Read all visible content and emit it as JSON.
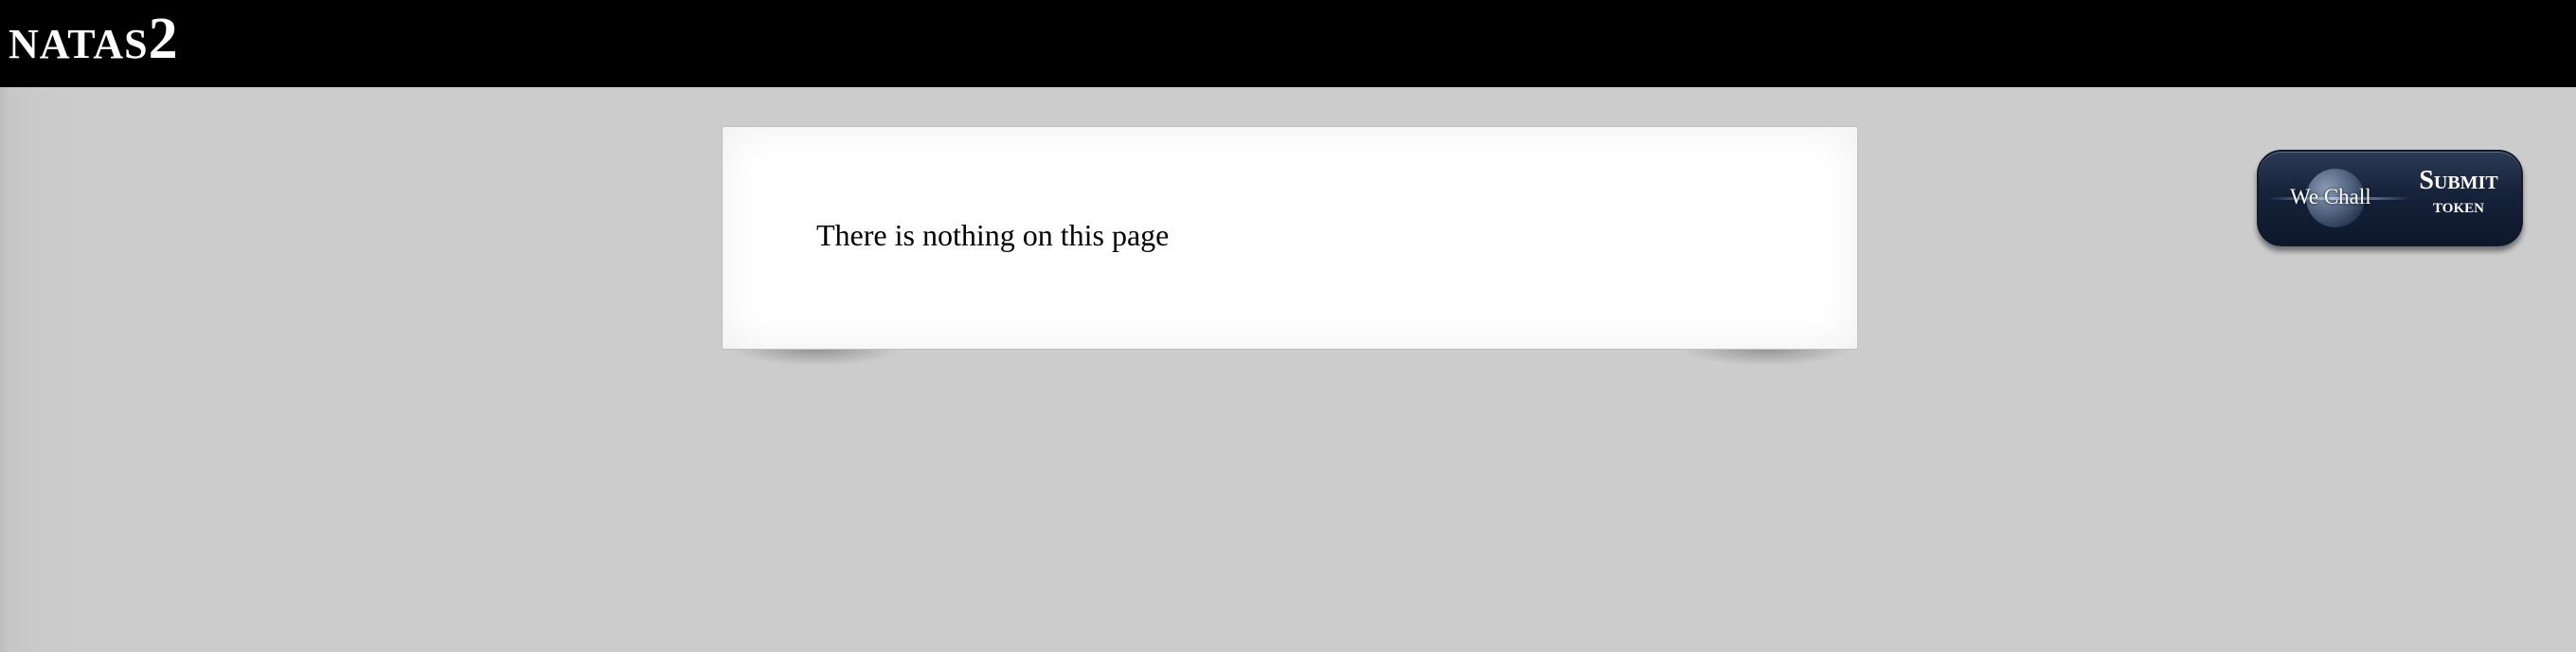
{
  "header": {
    "brand_name": "NATAS",
    "brand_level": "2"
  },
  "main": {
    "message": "There is nothing on this page"
  },
  "submit_token": {
    "logo_text": "We Chall",
    "line1": "Submit",
    "line2": "token",
    "icon": "globe-icon"
  },
  "colors": {
    "header_bg": "#000000",
    "page_bg": "#cccccc",
    "card_bg": "#ffffff",
    "button_bg": "#16223a"
  }
}
